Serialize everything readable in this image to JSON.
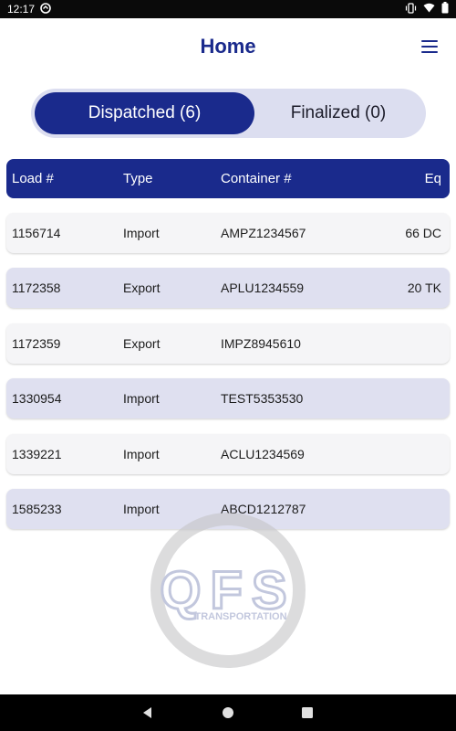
{
  "status_bar": {
    "time": "12:17"
  },
  "header": {
    "title": "Home"
  },
  "tabs": [
    {
      "label": "Dispatched (6)",
      "active": true
    },
    {
      "label": "Finalized (0)",
      "active": false
    }
  ],
  "table": {
    "columns": [
      "Load #",
      "Type",
      "Container #",
      "Eq"
    ],
    "rows": [
      {
        "load": "1156714",
        "type": "Import",
        "container": "AMPZ1234567",
        "eq": "66 DC"
      },
      {
        "load": "1172358",
        "type": "Export",
        "container": "APLU1234559",
        "eq": "20 TK"
      },
      {
        "load": "1172359",
        "type": "Export",
        "container": "IMPZ8945610",
        "eq": ""
      },
      {
        "load": "1330954",
        "type": "Import",
        "container": "TEST5353530",
        "eq": ""
      },
      {
        "load": "1339221",
        "type": "Import",
        "container": "ACLU1234569",
        "eq": ""
      },
      {
        "load": "1585233",
        "type": "Import",
        "container": "ABCD1212787",
        "eq": ""
      }
    ]
  },
  "logo": {
    "name": "QFS",
    "tagline": "TRANSPORTATION"
  },
  "colors": {
    "primary": "#1a2a8c",
    "row_alt": "#dfe0f0",
    "segment_bg": "#dcdef0"
  }
}
